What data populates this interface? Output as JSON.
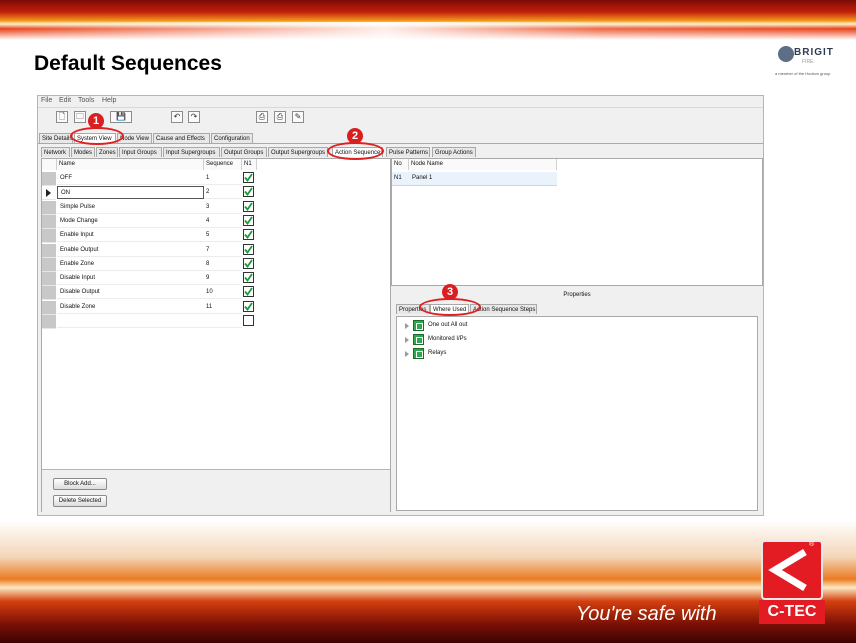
{
  "slide": {
    "title": "Default Sequences",
    "tagline": "You're safe with",
    "ctec_logo_text": "C-TEC",
    "registered_mark": "®",
    "brigit_logo": {
      "name": "BRIGIT",
      "sub": "FIRE",
      "note": "a member of the Hudson group"
    }
  },
  "menu": [
    "File",
    "Edit",
    "Tools",
    "Help"
  ],
  "toolbar_icons": [
    "new-file-icon",
    "open-folder-icon",
    "save-icon",
    "undo-icon",
    "redo-icon",
    "print-icon",
    "print-preview-icon",
    "export-icon"
  ],
  "main_tabs": [
    "Site Details",
    "System View",
    "Node View",
    "Cause and Effects",
    "Configuration"
  ],
  "sub_tabs": [
    "Network",
    "Modes",
    "Zones",
    "Input Groups",
    "Input Supergroups",
    "Output Groups",
    "Output Supergroups",
    "Action Sequences",
    "Pulse Patterns",
    "Group Actions"
  ],
  "sequence_table": {
    "columns": [
      "Name",
      "Sequence",
      "N1"
    ],
    "rows": [
      {
        "name": "OFF",
        "seq": "1",
        "n1": true
      },
      {
        "name": "ON",
        "seq": "2",
        "n1": true
      },
      {
        "name": "Simple Pulse",
        "seq": "3",
        "n1": true
      },
      {
        "name": "Mode Change",
        "seq": "4",
        "n1": true
      },
      {
        "name": "Enable Input",
        "seq": "5",
        "n1": true
      },
      {
        "name": "Enable Output",
        "seq": "7",
        "n1": true
      },
      {
        "name": "Enable Zone",
        "seq": "8",
        "n1": true
      },
      {
        "name": "Disable Input",
        "seq": "9",
        "n1": true
      },
      {
        "name": "Disable Output",
        "seq": "10",
        "n1": true
      },
      {
        "name": "Disable Zone",
        "seq": "11",
        "n1": true
      },
      {
        "name": "",
        "seq": "",
        "n1": false
      }
    ]
  },
  "buttons": {
    "block_add": "Block Add...",
    "delete_selected": "Delete Selected"
  },
  "node_table": {
    "columns": [
      "No",
      "Node Name"
    ],
    "rows": [
      {
        "no": "N1",
        "name": "Panel 1"
      }
    ]
  },
  "properties": {
    "title": "Properties",
    "tabs": [
      "Properties",
      "Where Used",
      "Action Sequence Steps"
    ],
    "tree": [
      "One out All out",
      "Monitored I/Ps",
      "Relays"
    ]
  },
  "callouts": [
    "1",
    "2",
    "3"
  ]
}
